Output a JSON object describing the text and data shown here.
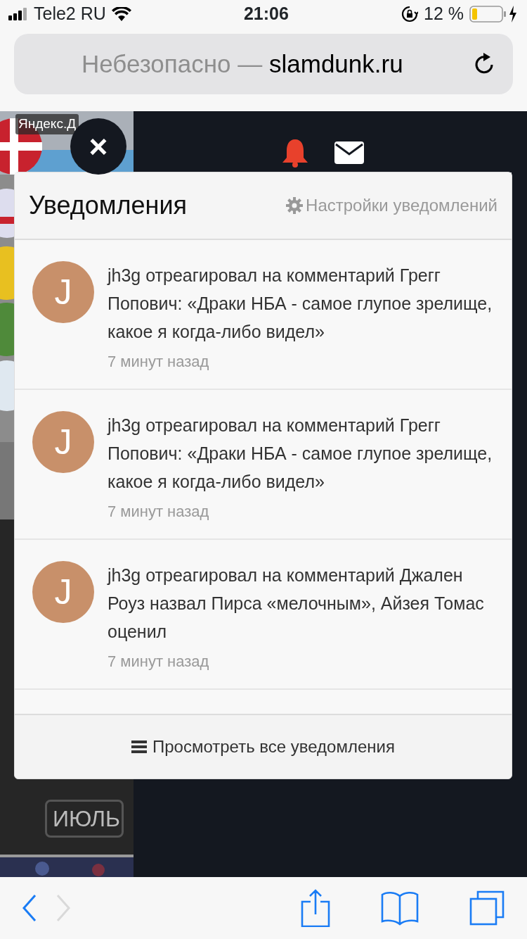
{
  "status_bar": {
    "carrier": "Tele2 RU",
    "time": "21:06",
    "battery": "12 %"
  },
  "address_bar": {
    "security": "Небезопасно —",
    "domain": "slamdunk.ru"
  },
  "page": {
    "ad_label": "Яндекс.Д",
    "month_label": "ИЮЛЬ"
  },
  "close_button": {
    "label": "×"
  },
  "notifications": {
    "title": "Уведомления",
    "settings_link": "Настройки уведомлений",
    "items": [
      {
        "avatar": "J",
        "text": "jh3g отреагировал на комментарий Грегг Попович: «Драки НБА - самое глупое зрелище, какое я когда-либо видел»",
        "time": "7 минут назад"
      },
      {
        "avatar": "J",
        "text": "jh3g отреагировал на комментарий Грегг Попович: «Драки НБА - самое глупое зрелище, какое я когда-либо видел»",
        "time": "7 минут назад"
      },
      {
        "avatar": "J",
        "text": "jh3g отреагировал на комментарий Джален Роуз назвал Пирса «мелочным», Айзея Томас оценил",
        "time": "7 минут назад"
      }
    ],
    "footer_link": "Просмотреть все уведомления"
  },
  "toolbar": {
    "back_disabled": false,
    "forward_disabled": true
  }
}
